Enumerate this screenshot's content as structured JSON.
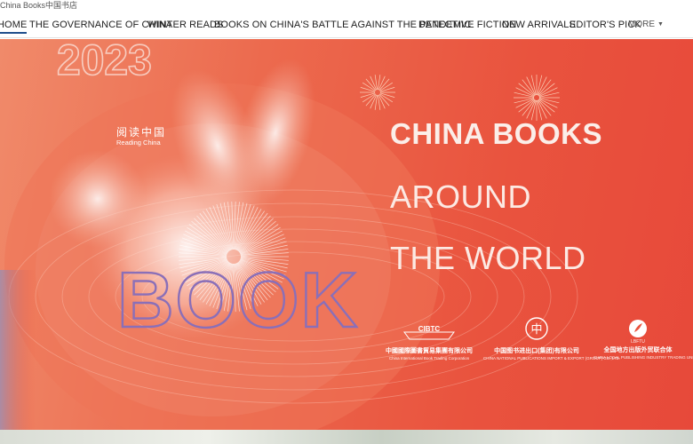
{
  "site": {
    "title": "China Books中国书店"
  },
  "nav": {
    "items": [
      {
        "label": "HOME",
        "active": true
      },
      {
        "label": "THE GOVERNANCE OF CHINA",
        "active": false
      },
      {
        "label": "WINTER READS",
        "active": false
      },
      {
        "label": "BOOKS ON CHINA'S BATTLE AGAINST THE PANDEMIC",
        "active": false
      },
      {
        "label": "DETECTIVE FICTION",
        "active": false
      },
      {
        "label": "NEW ARRIVALS",
        "active": false
      },
      {
        "label": "EDITOR'S PICK",
        "active": false
      }
    ],
    "more_label": "MORE"
  },
  "banner": {
    "year": "2023",
    "brand_cn": "阅读中国",
    "brand_en": "Reading China",
    "decor_word": "BOOK",
    "headline": [
      "CHINA BOOKS",
      "AROUND",
      "THE WORLD"
    ],
    "partners": [
      {
        "logo_text": "CIBTC",
        "name_cn": "中國國際圖書貿易集團有限公司",
        "name_en": "China International Book Trading Corporation"
      },
      {
        "logo_text": "中",
        "name_cn": "中国图书进出口(集团)有限公司",
        "name_en": "CHINA NATIONAL PUBLICATIONS IMPORT & EXPORT (GROUP) CO.,LTD."
      },
      {
        "logo_text": "LBFTU",
        "name_cn": "全国地方出版外贸联合体",
        "name_en": "CHINA LOCAL PUBLISHING INDUSTRY TRADING UNION"
      }
    ]
  },
  "colors": {
    "accent": "#1f4e8c",
    "banner_red": "#e9533e",
    "banner_peach": "#f08a6a"
  }
}
